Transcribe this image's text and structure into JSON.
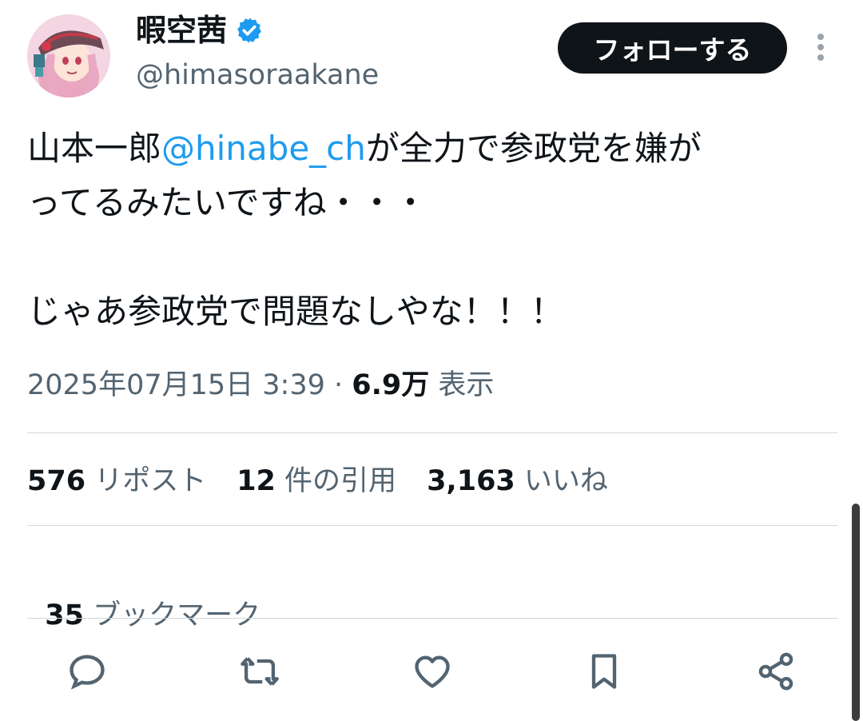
{
  "author": {
    "display_name": "暇空茜",
    "handle": "@himasoraakane",
    "verified": true
  },
  "follow_button_label": "フォローする",
  "more_icon": "vertical-dots-icon",
  "tweet": {
    "line1_before": "山本一郎",
    "mention": "@hinabe_ch",
    "line1_after": "が全力で参政党を嫌が",
    "line2": "ってるみたいですね・・・",
    "line3": "",
    "line4": "じゃあ参政党で問題なしやな！！！"
  },
  "meta": {
    "timestamp": "2025年07月15日 3:39",
    "separator": " · ",
    "views_count": "6.9万",
    "views_label": " 表示"
  },
  "stats": {
    "reposts_count": "576",
    "reposts_label": " リポスト",
    "quotes_count": "12",
    "quotes_label": " 件の引用",
    "likes_count": "3,163",
    "likes_label": " いいね"
  },
  "bookmarks": {
    "count": "35",
    "label": " ブックマーク"
  },
  "actions": [
    {
      "icon": "reply-icon"
    },
    {
      "icon": "repost-icon"
    },
    {
      "icon": "like-icon"
    },
    {
      "icon": "bookmark-icon"
    },
    {
      "icon": "share-icon"
    }
  ],
  "colors": {
    "text": "#0f1419",
    "secondary": "#536471",
    "link": "#1d9bf0",
    "divider": "#cfd9de",
    "verified": "#1d9bf0"
  }
}
